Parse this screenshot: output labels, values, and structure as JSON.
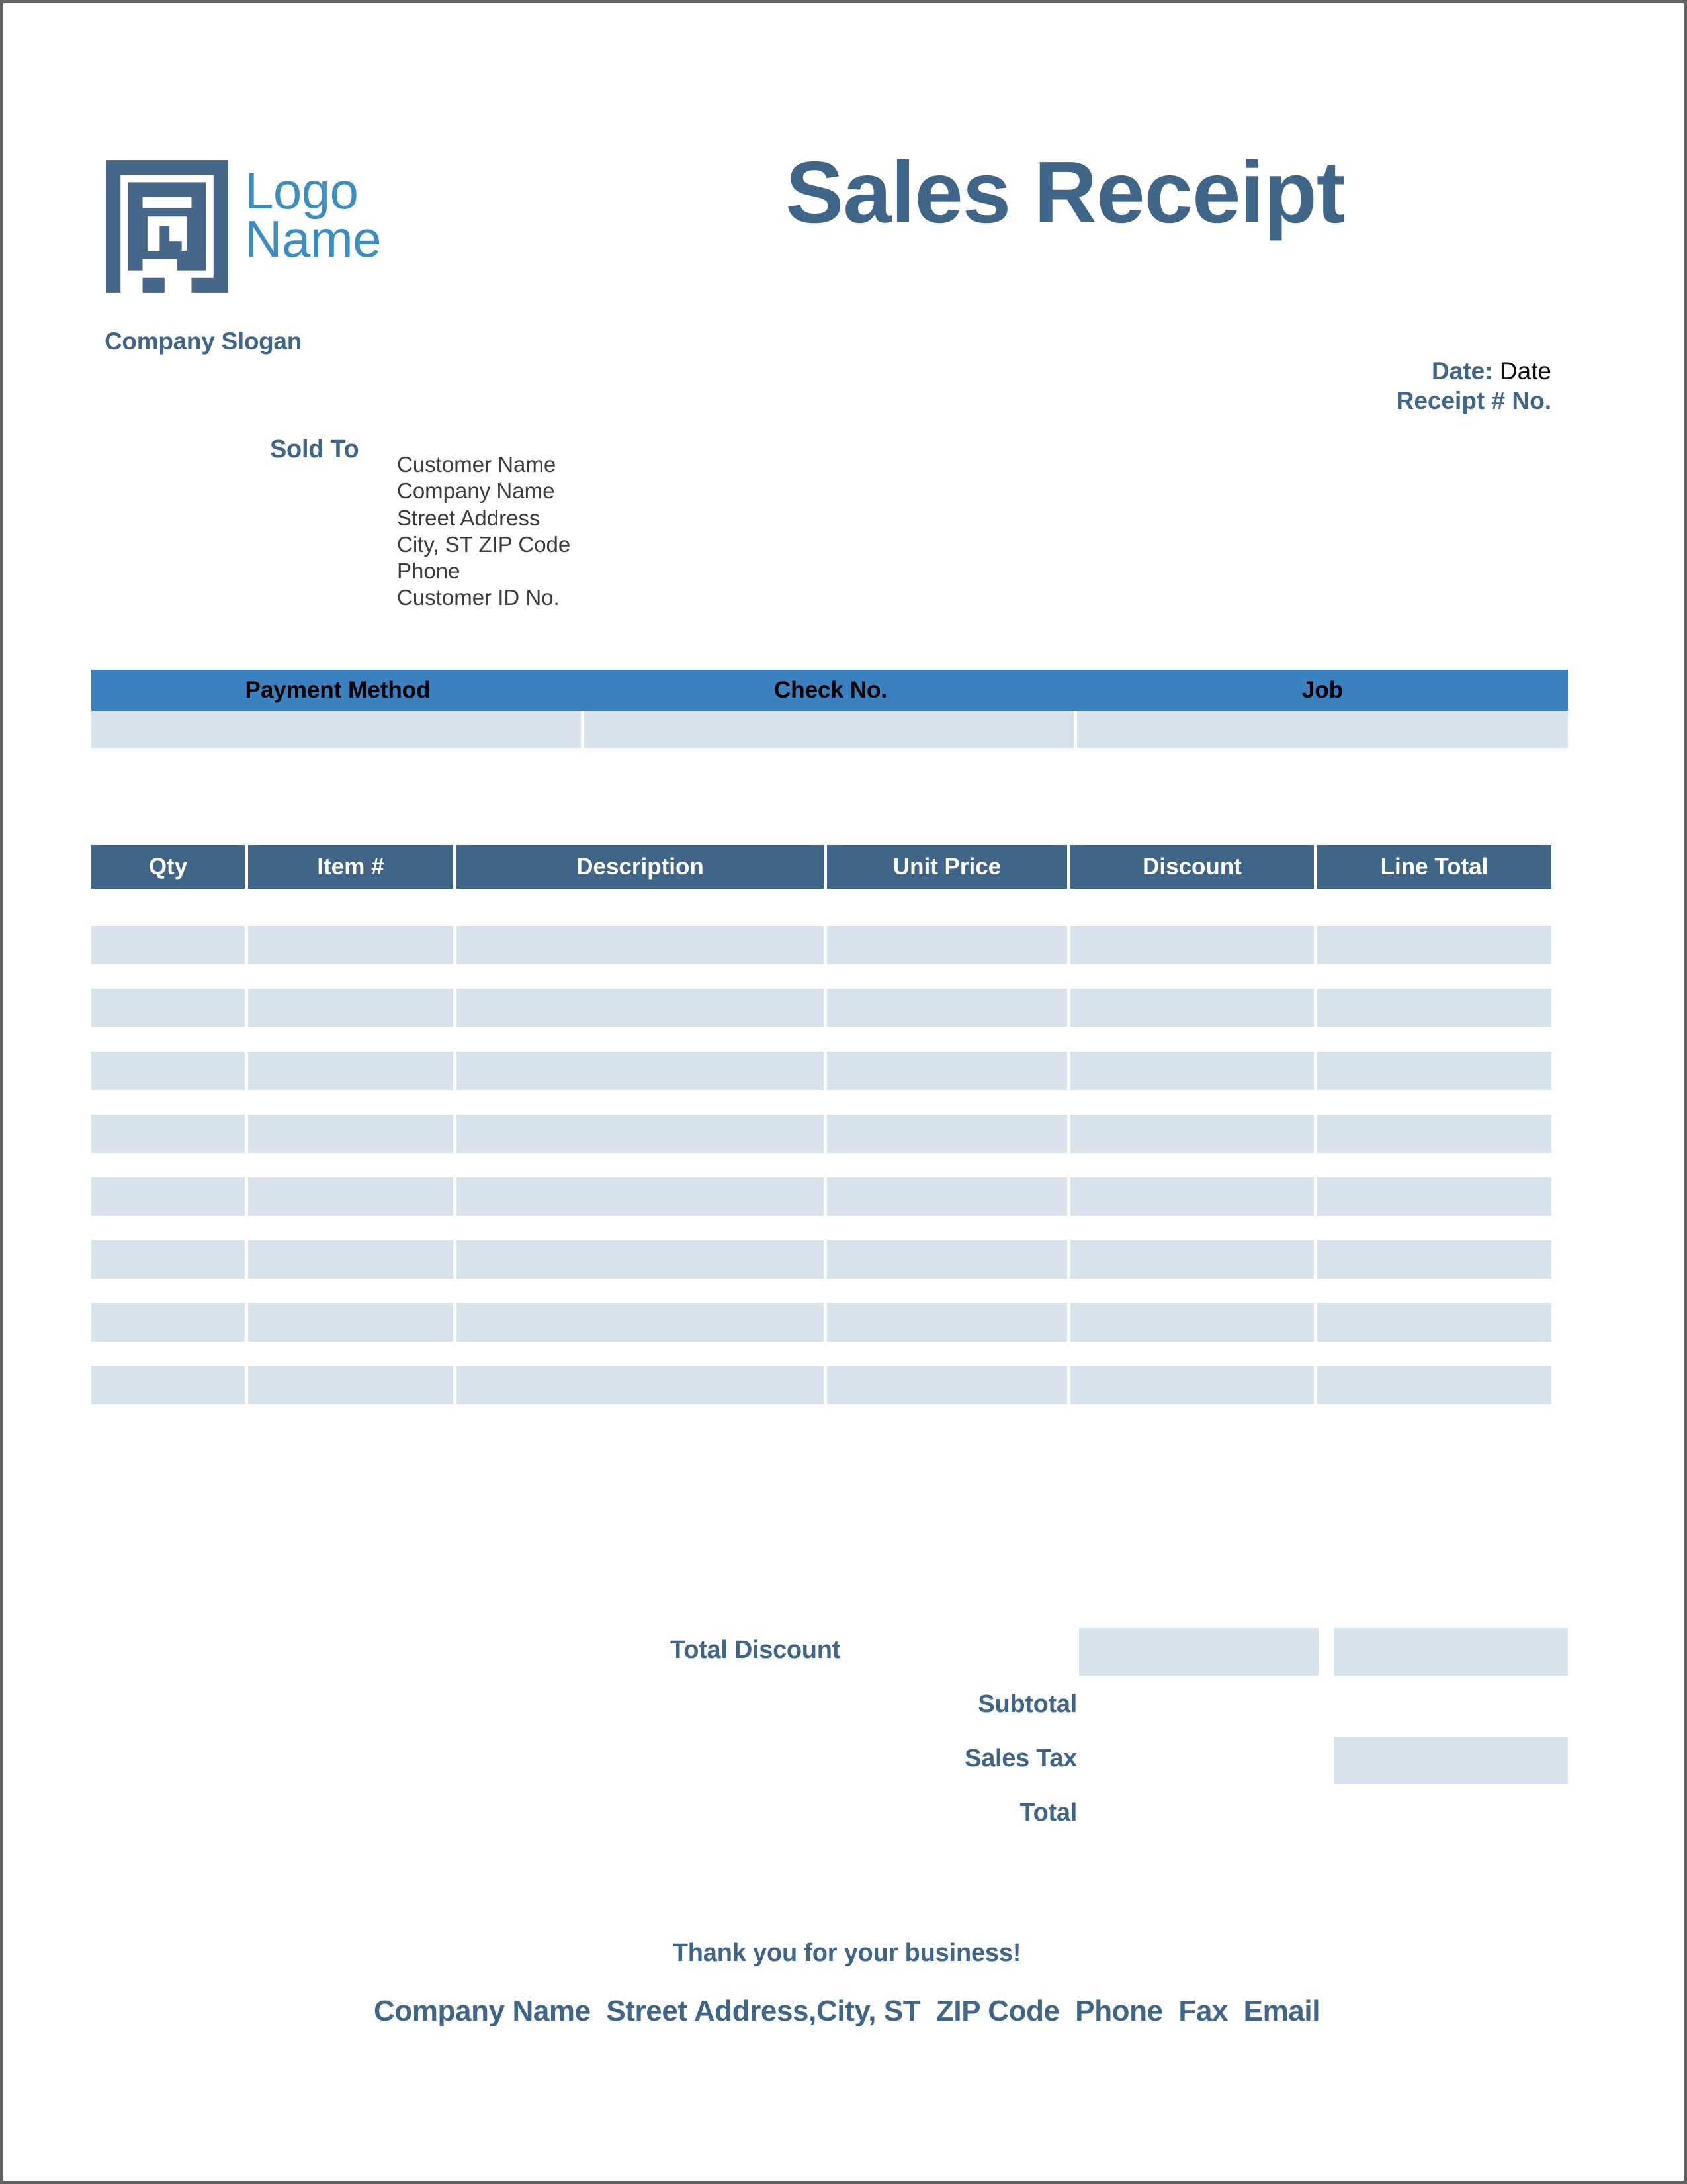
{
  "document": {
    "title": "Sales Receipt"
  },
  "brand": {
    "logo_icon": "maze-square-logo",
    "logo_name": "Logo\nName",
    "slogan": "Company Slogan",
    "accent_dark": "#3f6589",
    "accent_light": "#3b80bf",
    "accent_logo_text": "#3d8ec0",
    "field_fill": "#d8e2ec"
  },
  "meta": {
    "date_label": "Date:",
    "date_value": "Date",
    "receipt_label": "Receipt # No."
  },
  "sold_to": {
    "label": "Sold To",
    "lines": [
      "Customer Name",
      "Company Name",
      "Street Address",
      "City, ST  ZIP Code",
      "Phone",
      "Customer ID No."
    ]
  },
  "payment": {
    "headers": [
      "Payment Method",
      "Check No.",
      "Job"
    ],
    "values": [
      "",
      "",
      ""
    ]
  },
  "items": {
    "headers": [
      "Qty",
      "Item #",
      "Description",
      "Unit Price",
      "Discount",
      "Line Total"
    ],
    "rows": [
      [
        "",
        "",
        "",
        "",
        "",
        ""
      ],
      [
        "",
        "",
        "",
        "",
        "",
        ""
      ],
      [
        "",
        "",
        "",
        "",
        "",
        ""
      ],
      [
        "",
        "",
        "",
        "",
        "",
        ""
      ],
      [
        "",
        "",
        "",
        "",
        "",
        ""
      ],
      [
        "",
        "",
        "",
        "",
        "",
        ""
      ],
      [
        "",
        "",
        "",
        "",
        "",
        ""
      ],
      [
        "",
        "",
        "",
        "",
        "",
        ""
      ]
    ]
  },
  "totals": {
    "total_discount_label": "Total Discount",
    "total_discount_value": "",
    "total_discount_line_value": "",
    "subtotal_label": "Subtotal",
    "subtotal_value": "",
    "sales_tax_label": "Sales Tax",
    "sales_tax_value": "",
    "total_label": "Total",
    "total_value": ""
  },
  "footer": {
    "thanks": "Thank you for your business!",
    "contact": "Company Name  Street Address,City, ST  ZIP Code  Phone  Fax  Email"
  }
}
